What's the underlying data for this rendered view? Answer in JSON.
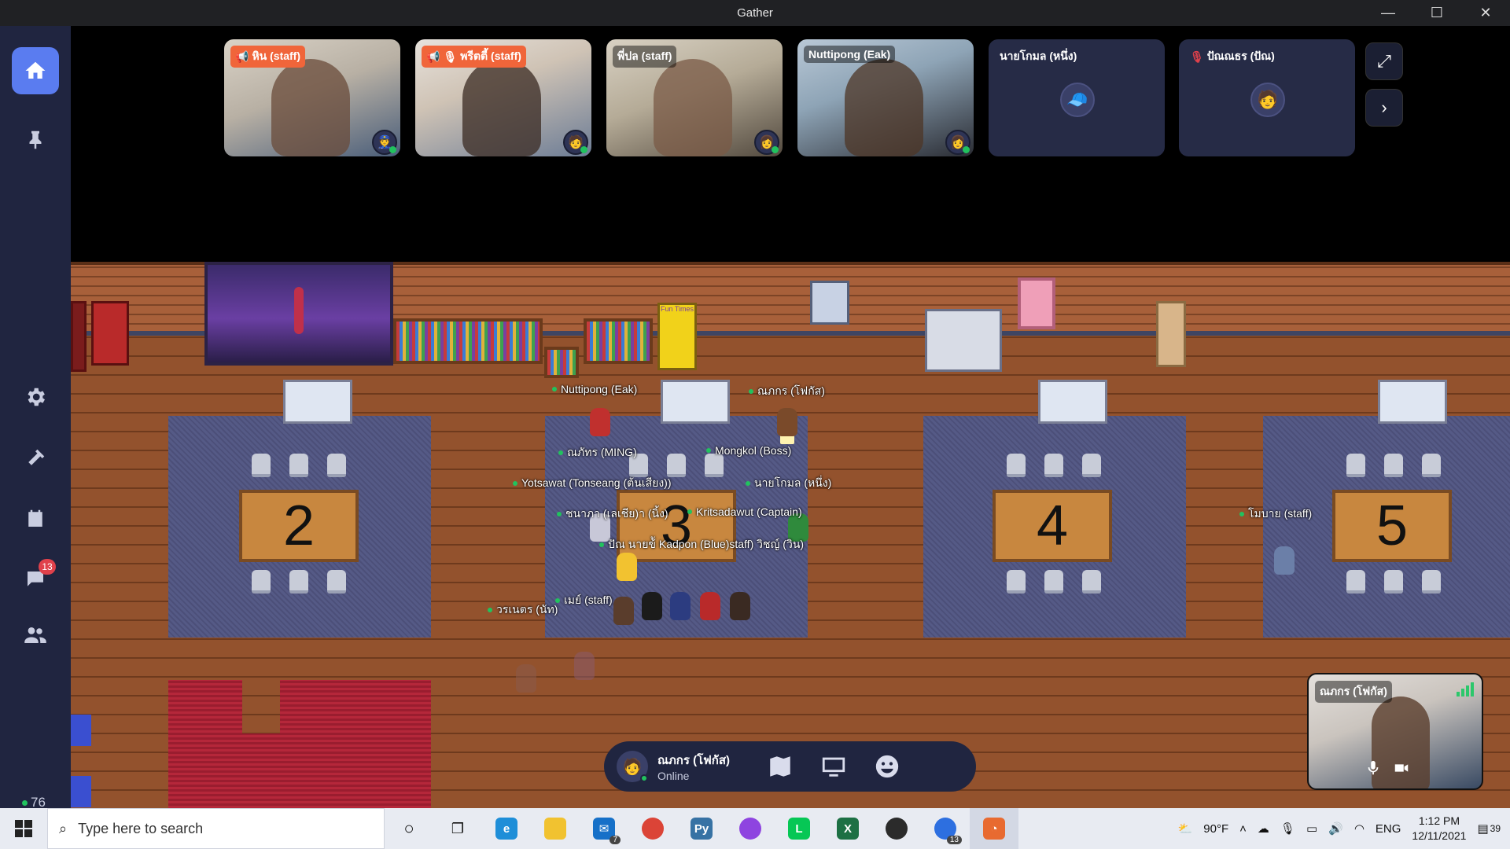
{
  "window": {
    "title": "Gather",
    "minimize": "—",
    "maximize": "☐",
    "close": "✕"
  },
  "rail": {
    "chat_badge": "13",
    "people_count": "76"
  },
  "video_tiles": [
    {
      "name": "หิน (staff)",
      "style": "orange"
    },
    {
      "name": "พรีตตี้ (staff)",
      "style": "orange"
    },
    {
      "name": "พี่ปล (staff)",
      "style": "plain"
    },
    {
      "name": "Nuttipong (Eak)",
      "style": "plain"
    },
    {
      "name": "นายโกมล (หนึ่ง)",
      "style": "plain"
    },
    {
      "name": "ปัณณธร (ปัณ)",
      "style": "plain"
    }
  ],
  "map": {
    "tables": [
      "2",
      "3",
      "4",
      "5"
    ],
    "poster_text": "Fun Times",
    "players": [
      "Nuttipong (Eak)",
      "ณภกร (โฟกัส)",
      "ณภัทร (MING)",
      "Mongkol (Boss)",
      "Yotsawat (Tonseang (ต้นเสียง))",
      "นายโกมล (หนึ่ง)",
      "ชนาภา (เลเชีย)า (นิ้ง)",
      "Kritsadawut (Captain)",
      "ปัณ นายข้ั Kadpon (Blue)staff) วิชญ์ (วิน)",
      "เมย์ (staff)",
      "วรเนตร (นัท)",
      "โมบาย (staff)"
    ]
  },
  "player_bar": {
    "name": "ณภกร (โฟกัส)",
    "status": "Online"
  },
  "self_view": {
    "name": "ณภกร (โฟกัส)"
  },
  "taskbar": {
    "search_placeholder": "Type here to search",
    "weather": "90°F",
    "lang": "ENG",
    "time": "1:12 PM",
    "date": "12/11/2021",
    "notifications": "39",
    "mail_badge": "7",
    "messenger_badge": "13"
  }
}
